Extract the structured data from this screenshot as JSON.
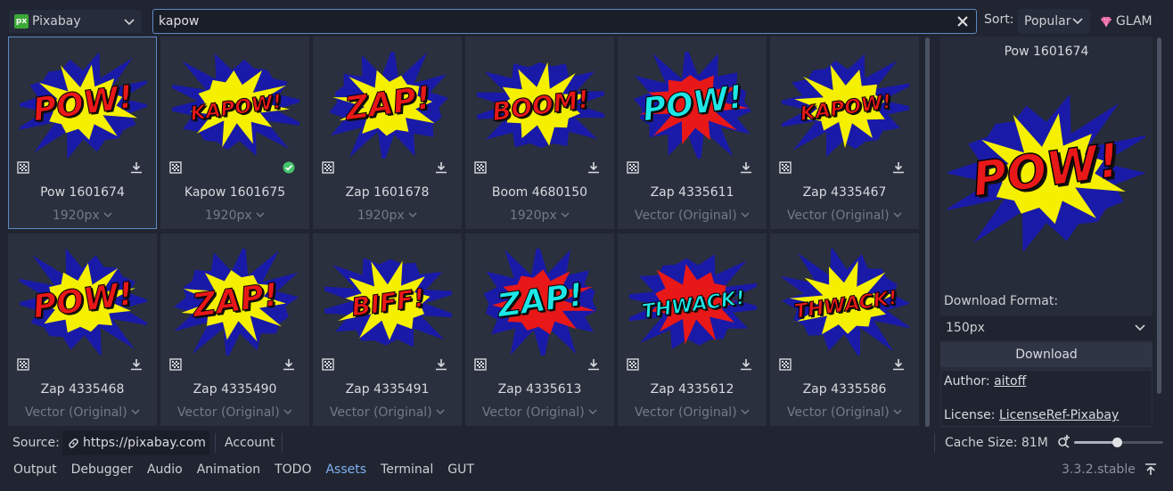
{
  "provider": {
    "label": "Pixabay",
    "logo_text": "px",
    "icon": "chevron-down-icon"
  },
  "search": {
    "value": "kapow",
    "clear_icon": "close-icon"
  },
  "sort": {
    "label": "Sort:",
    "value": "Popular"
  },
  "glam": {
    "label": "GLAM",
    "icon": "gem-icon"
  },
  "assets": [
    {
      "word": "POW!",
      "palette": "red",
      "title": "Pow 1601674",
      "format": "1920px",
      "downloaded": false,
      "selected": true
    },
    {
      "word": "KAPOW!",
      "palette": "red",
      "title": "Kapow 1601675",
      "format": "1920px",
      "downloaded": true,
      "selected": false
    },
    {
      "word": "ZAP!",
      "palette": "red",
      "title": "Zap 1601678",
      "format": "1920px",
      "downloaded": false,
      "selected": false
    },
    {
      "word": "BOOM!",
      "palette": "red",
      "title": "Boom 4680150",
      "format": "1920px",
      "downloaded": false,
      "selected": false
    },
    {
      "word": "POW!",
      "palette": "cyan",
      "title": "Zap 4335611",
      "format": "Vector (Original)",
      "downloaded": false,
      "selected": false
    },
    {
      "word": "KAPOW!",
      "palette": "red",
      "title": "Zap 4335467",
      "format": "Vector (Original)",
      "downloaded": false,
      "selected": false
    },
    {
      "word": "POW!",
      "palette": "red",
      "title": "Zap 4335468",
      "format": "Vector (Original)",
      "downloaded": false,
      "selected": false
    },
    {
      "word": "ZAP!",
      "palette": "red",
      "title": "Zap 4335490",
      "format": "Vector (Original)",
      "downloaded": false,
      "selected": false
    },
    {
      "word": "BIFF!",
      "palette": "red",
      "title": "Zap 4335491",
      "format": "Vector (Original)",
      "downloaded": false,
      "selected": false
    },
    {
      "word": "ZAP!",
      "palette": "cyan",
      "title": "Zap 4335613",
      "format": "Vector (Original)",
      "downloaded": false,
      "selected": false
    },
    {
      "word": "THWACK!",
      "palette": "cyan",
      "title": "Zap 4335612",
      "format": "Vector (Original)",
      "downloaded": false,
      "selected": false
    },
    {
      "word": "THWACK!",
      "palette": "red",
      "title": "Zap 4335586",
      "format": "Vector (Original)",
      "downloaded": false,
      "selected": false
    }
  ],
  "preview": {
    "title": "Pow 1601674",
    "word": "POW!",
    "download_format_label": "Download Format:",
    "download_format_value": "150px",
    "download_button": "Download",
    "author_label": "Author:",
    "author_value": "aitoff",
    "license_label": "License:",
    "license_value": "LicenseRef-Pixabay"
  },
  "status": {
    "source_label": "Source:",
    "source_url": "https://pixabay.com",
    "account": "Account",
    "cache": "Cache Size: 81M",
    "zoom_level": 0.48
  },
  "bottom_tabs": [
    "Output",
    "Debugger",
    "Audio",
    "Animation",
    "TODO",
    "Assets",
    "Terminal",
    "GUT"
  ],
  "active_tab": "Assets",
  "version": "3.3.2.stable",
  "colors": {
    "accent": "#7fb0f0",
    "burst_outer": "#1a1aa8",
    "burst_inner": "#f5f000",
    "text_red": "#e81818",
    "text_cyan": "#1de6e6"
  }
}
